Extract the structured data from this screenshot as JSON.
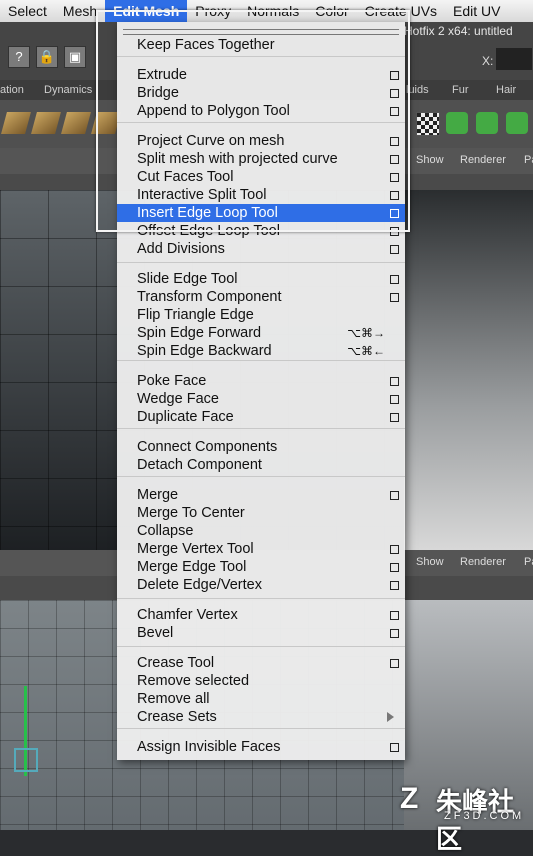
{
  "menubar": {
    "items": [
      "Select",
      "Mesh",
      "Edit Mesh",
      "Proxy",
      "Normals",
      "Color",
      "Create UVs",
      "Edit UV"
    ],
    "active_index": 2
  },
  "background": {
    "window_title": "Hotfix 2 x64: untitled",
    "x_label": "X:",
    "shelf_tabs": [
      "ation",
      "Dynamics",
      "luids",
      "Fur",
      "Hair"
    ],
    "panel_menu": [
      "Show",
      "Renderer",
      "Pa"
    ]
  },
  "menu": {
    "title": "Edit Mesh",
    "items": [
      {
        "label": "Keep Faces Together",
        "option_box": false
      },
      {
        "label": "Extrude",
        "option_box": true
      },
      {
        "label": "Bridge",
        "option_box": true
      },
      {
        "label": "Append to Polygon Tool",
        "option_box": true
      },
      {
        "label": "Project Curve on mesh",
        "option_box": true
      },
      {
        "label": "Split mesh with projected curve",
        "option_box": true
      },
      {
        "label": "Cut Faces Tool",
        "option_box": true
      },
      {
        "label": "Interactive Split Tool",
        "option_box": true
      },
      {
        "label": "Insert Edge Loop Tool",
        "option_box": true,
        "highlighted": true
      },
      {
        "label": "Offset Edge Loop Tool",
        "option_box": true
      },
      {
        "label": "Add Divisions",
        "option_box": true
      },
      {
        "label": "Slide Edge Tool",
        "option_box": true
      },
      {
        "label": "Transform Component",
        "option_box": true
      },
      {
        "label": "Flip Triangle Edge",
        "option_box": false
      },
      {
        "label": "Spin Edge Forward",
        "shortcut": "⌥⌘→"
      },
      {
        "label": "Spin Edge Backward",
        "shortcut": "⌥⌘←"
      },
      {
        "label": "Poke Face",
        "option_box": true
      },
      {
        "label": "Wedge Face",
        "option_box": true
      },
      {
        "label": "Duplicate Face",
        "option_box": true
      },
      {
        "label": "Connect Components",
        "option_box": false
      },
      {
        "label": "Detach Component",
        "option_box": false
      },
      {
        "label": "Merge",
        "option_box": true
      },
      {
        "label": "Merge To Center",
        "option_box": false
      },
      {
        "label": "Collapse",
        "option_box": false
      },
      {
        "label": "Merge Vertex Tool",
        "option_box": true
      },
      {
        "label": "Merge Edge Tool",
        "option_box": true
      },
      {
        "label": "Delete Edge/Vertex",
        "option_box": true
      },
      {
        "label": "Chamfer Vertex",
        "option_box": true
      },
      {
        "label": "Bevel",
        "option_box": true
      },
      {
        "label": "Crease Tool",
        "option_box": true
      },
      {
        "label": "Remove selected",
        "option_box": false
      },
      {
        "label": "Remove all",
        "option_box": false
      },
      {
        "label": "Crease Sets",
        "submenu": true
      },
      {
        "label": "Assign Invisible Faces",
        "option_box": true
      }
    ]
  },
  "watermark": {
    "logo": "Z",
    "cn": "朱峰社区",
    "en": "ZF3D.COM"
  },
  "colors": {
    "highlight": "#2f6ee6",
    "menu_bg": "#eeeeee"
  }
}
